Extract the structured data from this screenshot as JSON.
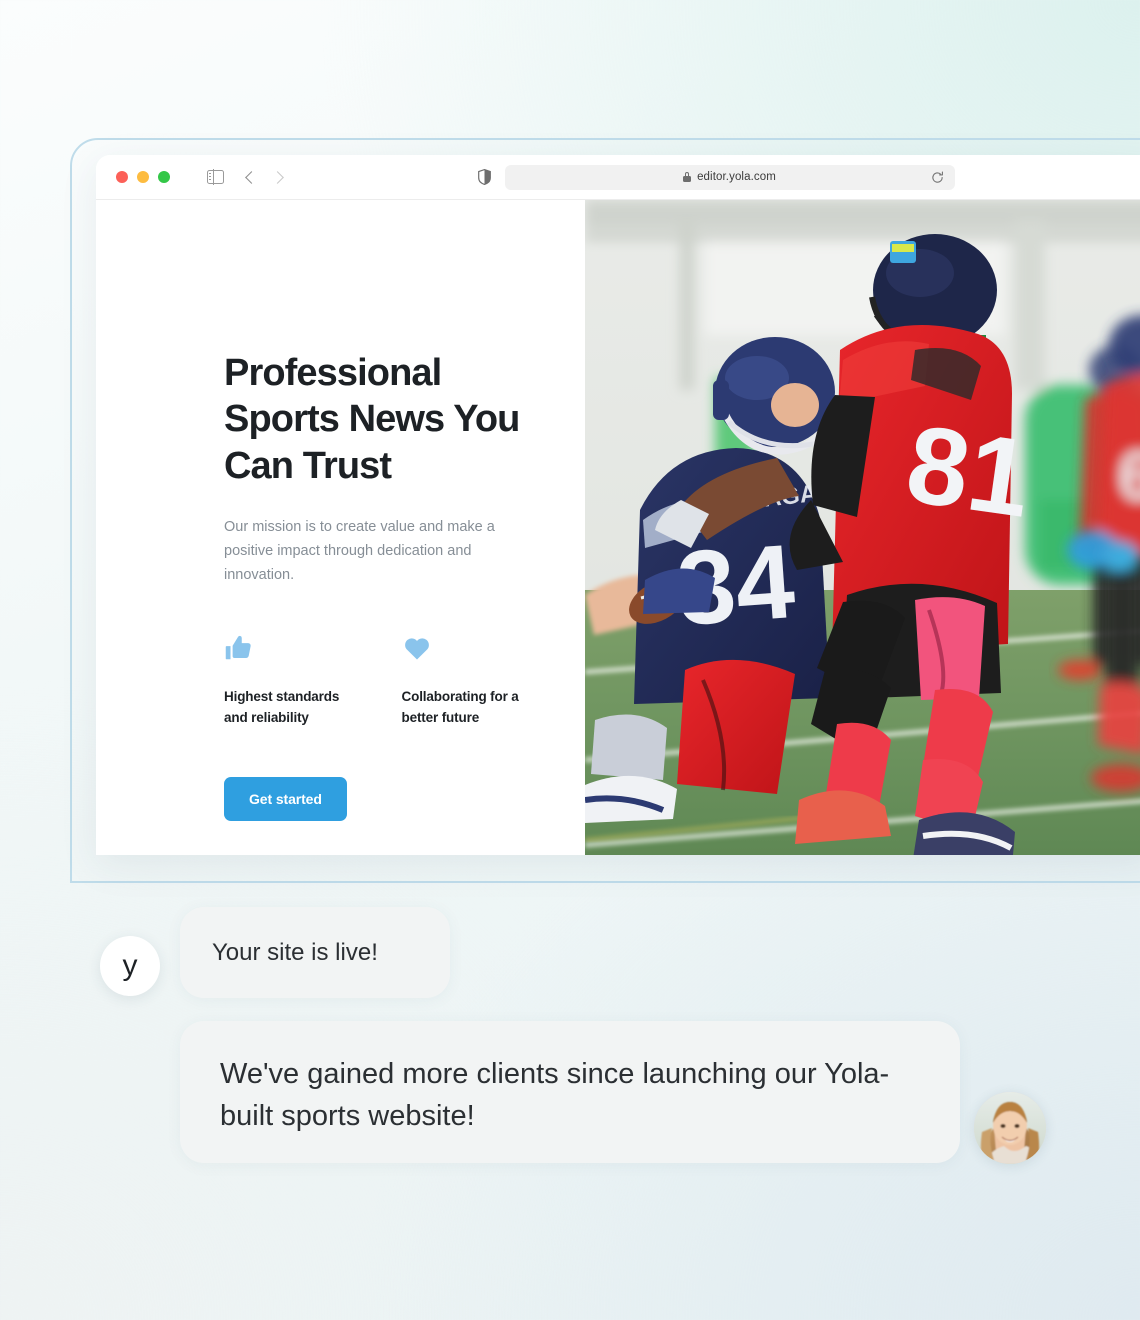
{
  "browser": {
    "url": "editor.yola.com",
    "icons": {
      "sidebar": "sidebar-toggle-icon",
      "back": "back-chevron-icon",
      "forward": "forward-chevron-icon",
      "shield": "privacy-shield-icon",
      "lock": "lock-icon",
      "reload": "reload-icon"
    },
    "window_controls": [
      "close",
      "minimize",
      "zoom"
    ]
  },
  "hero": {
    "headline": "Professional Sports News You Can Trust",
    "subtext": "Our mission is to create value and make a positive impact through dedication and innovation.",
    "features": [
      {
        "icon": "thumbs-up-icon",
        "label": "Highest standards and reliability"
      },
      {
        "icon": "heart-icon",
        "label": "Collaborating for a better future"
      }
    ],
    "cta_label": "Get started",
    "image_alt": "American football players on green turf field"
  },
  "chat": {
    "logo_letter": "y",
    "messages": [
      {
        "text": "Your site is live!"
      },
      {
        "text": "We've gained more clients since launching our Yola-built sports website!"
      }
    ],
    "avatar_alt": "smiling woman portrait"
  },
  "colors": {
    "accent": "#2f9fe0",
    "feature_icon": "#8ac4ec",
    "headline": "#1d2125",
    "subtext": "#868e96",
    "bubble_bg": "#f2f4f4",
    "frame_border": "#bfdcea"
  }
}
